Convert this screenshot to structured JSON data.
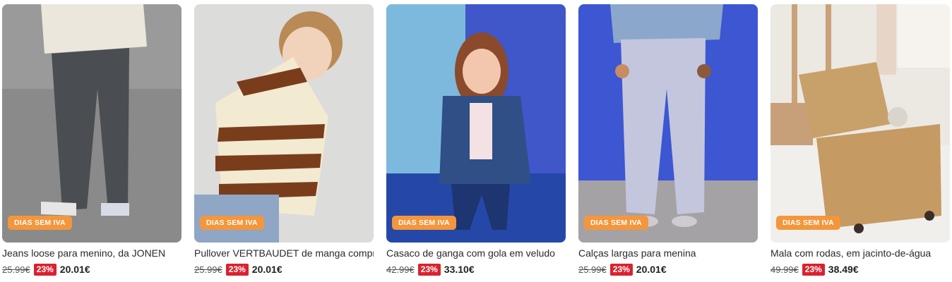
{
  "products": [
    {
      "name": "Jeans loose para menino, da JONEN",
      "badge": "DIAS SEM IVA",
      "old_price": "25.99€",
      "discount": "23%",
      "price": "20.01€"
    },
    {
      "name": "Pullover VERTBAUDET de manga comprida",
      "badge": "DIAS SEM IVA",
      "old_price": "25.99€",
      "discount": "23%",
      "price": "20.01€"
    },
    {
      "name": "Casaco de ganga com gola em veludo",
      "badge": "DIAS SEM IVA",
      "old_price": "42.99€",
      "discount": "23%",
      "price": "33.10€"
    },
    {
      "name": "Calças largas para menina",
      "badge": "DIAS SEM IVA",
      "old_price": "25.99€",
      "discount": "23%",
      "price": "20.01€"
    },
    {
      "name": "Mala com rodas, em jacinto-de-água",
      "badge": "DIAS SEM IVA",
      "old_price": "49.99€",
      "discount": "23%",
      "price": "38.49€"
    }
  ],
  "colors": {
    "badge": "#f4963c",
    "discount": "#d9232f"
  }
}
